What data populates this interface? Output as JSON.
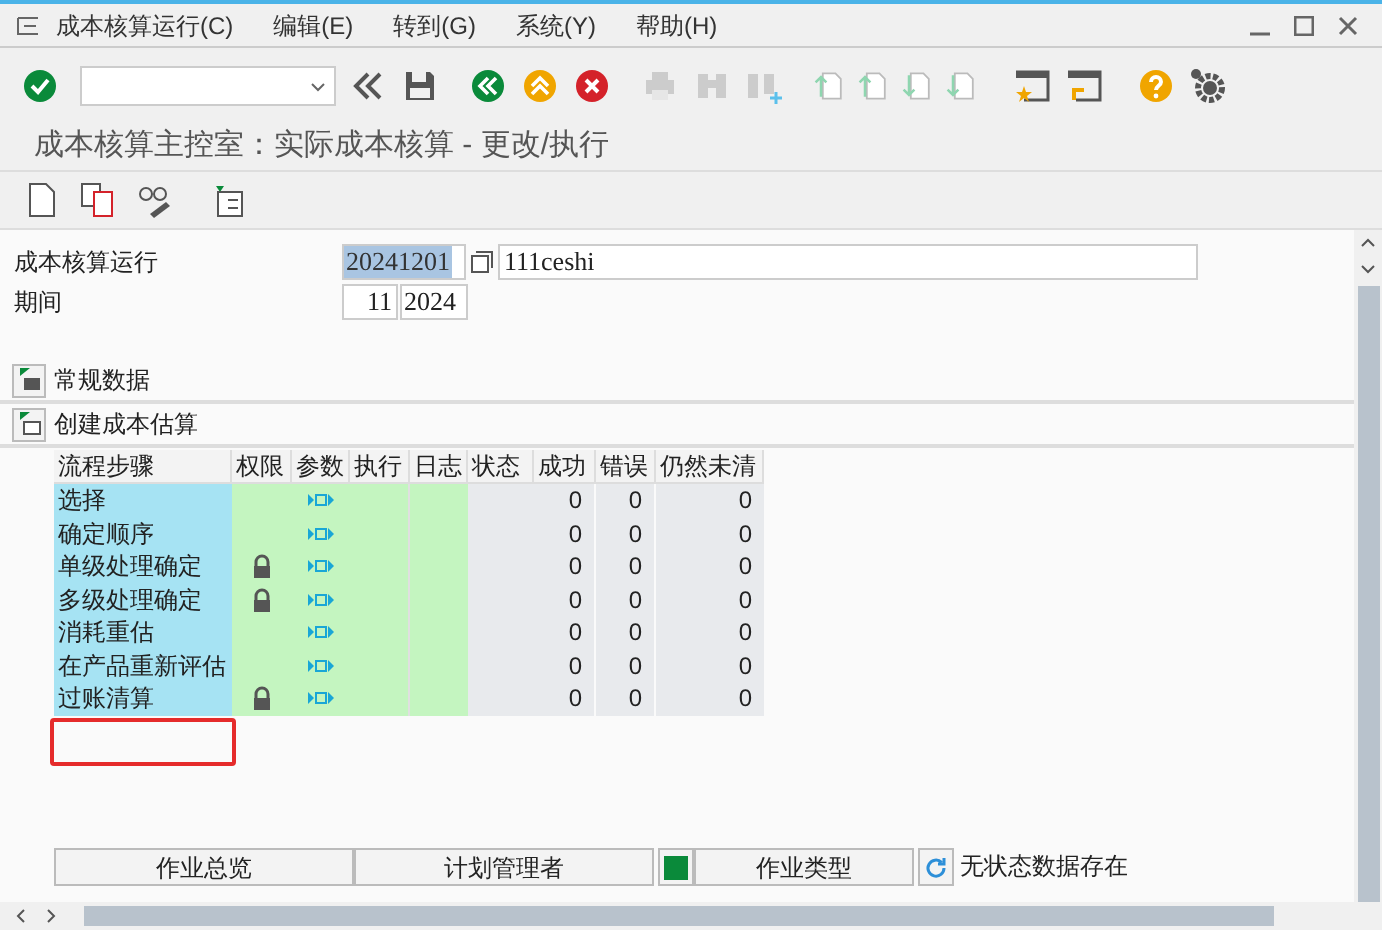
{
  "menu": [
    "成本核算运行(C)",
    "编辑(E)",
    "转到(G)",
    "系统(Y)",
    "帮助(H)"
  ],
  "title": "成本核算主控室：实际成本核算 - 更改/执行",
  "fields": {
    "run_label": "成本核算运行",
    "run_value": "20241201",
    "run_description": "111ceshi",
    "period_label": "期间",
    "period_value": "11",
    "year_value": "2024"
  },
  "sections": [
    {
      "label": "常规数据",
      "expanded": false
    },
    {
      "label": "创建成本估算",
      "expanded": true
    }
  ],
  "table": {
    "columns": [
      "流程步骤",
      "权限",
      "参数",
      "执行",
      "日志",
      "状态",
      "成功",
      "错误",
      "仍然未清"
    ],
    "rows": [
      {
        "step": "选择",
        "locked": false,
        "success": "0",
        "error": "0",
        "open": "0"
      },
      {
        "step": "确定顺序",
        "locked": false,
        "success": "0",
        "error": "0",
        "open": "0"
      },
      {
        "step": "单级处理确定",
        "locked": true,
        "success": "0",
        "error": "0",
        "open": "0"
      },
      {
        "step": "多级处理确定",
        "locked": true,
        "success": "0",
        "error": "0",
        "open": "0"
      },
      {
        "step": "消耗重估",
        "locked": false,
        "success": "0",
        "error": "0",
        "open": "0"
      },
      {
        "step": "在产品重新评估",
        "locked": false,
        "success": "0",
        "error": "0",
        "open": "0"
      },
      {
        "step": "过账清算",
        "locked": true,
        "success": "0",
        "error": "0",
        "open": "0"
      }
    ]
  },
  "bottom_bar": {
    "buttons": [
      "作业总览",
      "计划管理者",
      "作业类型"
    ],
    "status": "无状态数据存在"
  }
}
